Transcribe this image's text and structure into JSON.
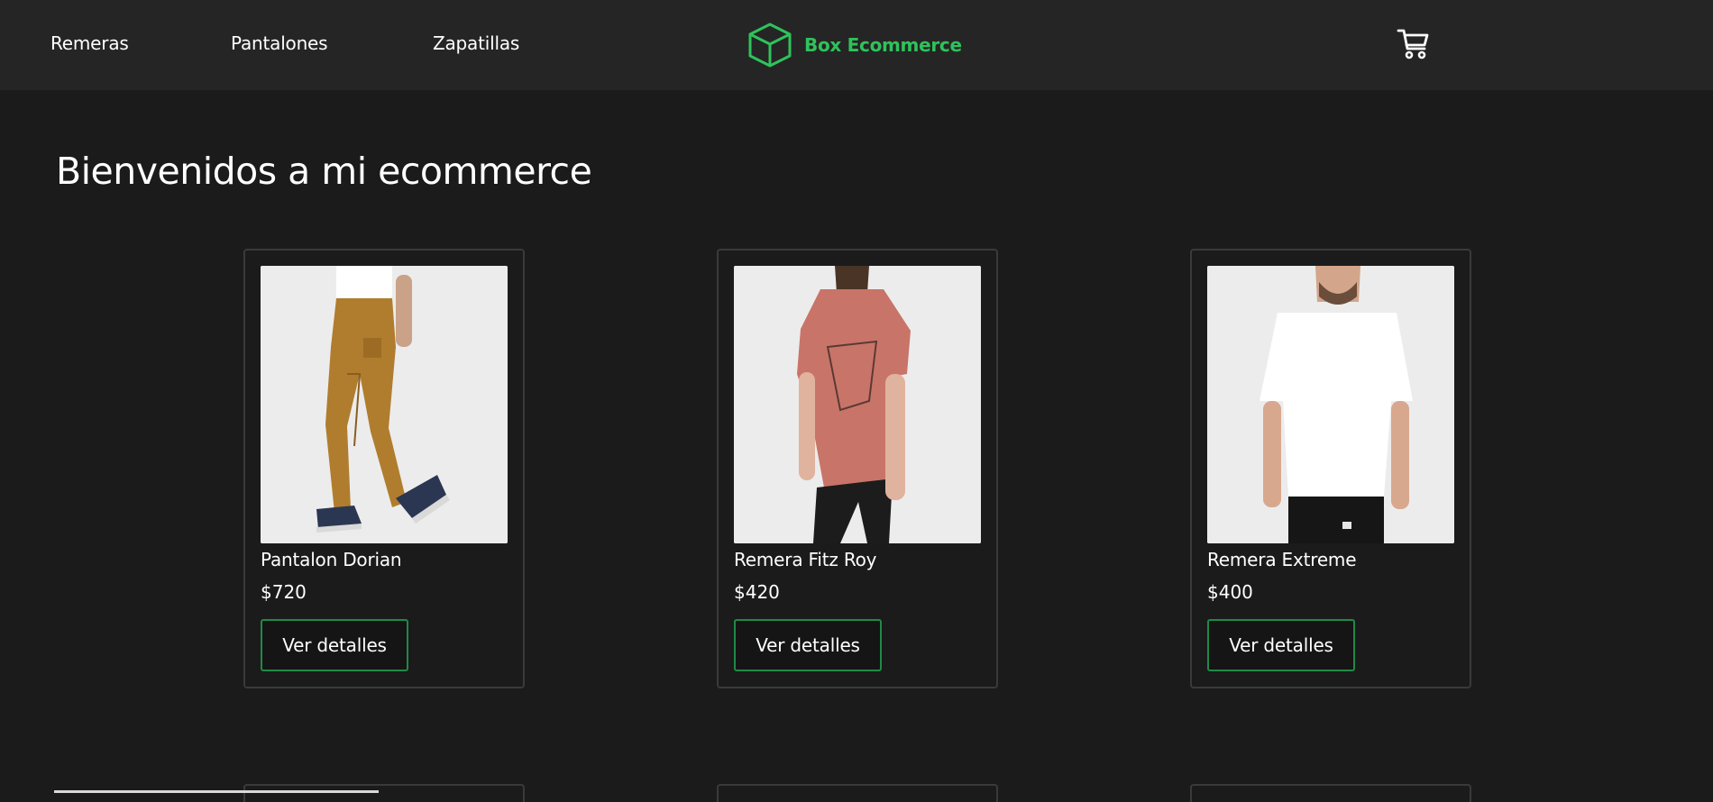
{
  "nav": {
    "links": [
      "Remeras",
      "Pantalones",
      "Zapatillas"
    ],
    "brand": "Box Ecommerce",
    "brand_icon": "cube-icon",
    "cart_icon": "shopping-cart-icon",
    "brand_color": "#2fc25b"
  },
  "main": {
    "title": "Bienvenidos a mi ecommerce"
  },
  "products": [
    {
      "name": "Pantalon Dorian",
      "price": "$720",
      "button": "Ver detalles",
      "image": "photo: man in tan cargo pants and hiking shoes"
    },
    {
      "name": "Remera Fitz Roy",
      "price": "$420",
      "button": "Ver detalles",
      "image": "photo: woman in coral t-shirt with mountain print"
    },
    {
      "name": "Remera Extreme",
      "price": "$400",
      "button": "Ver detalles",
      "image": "photo: man in white oversized t-shirt"
    }
  ],
  "colors": {
    "background": "#1b1b1b",
    "navbar": "#252525",
    "button_border": "#1f8a47",
    "card_border": "#3a3a3a"
  }
}
